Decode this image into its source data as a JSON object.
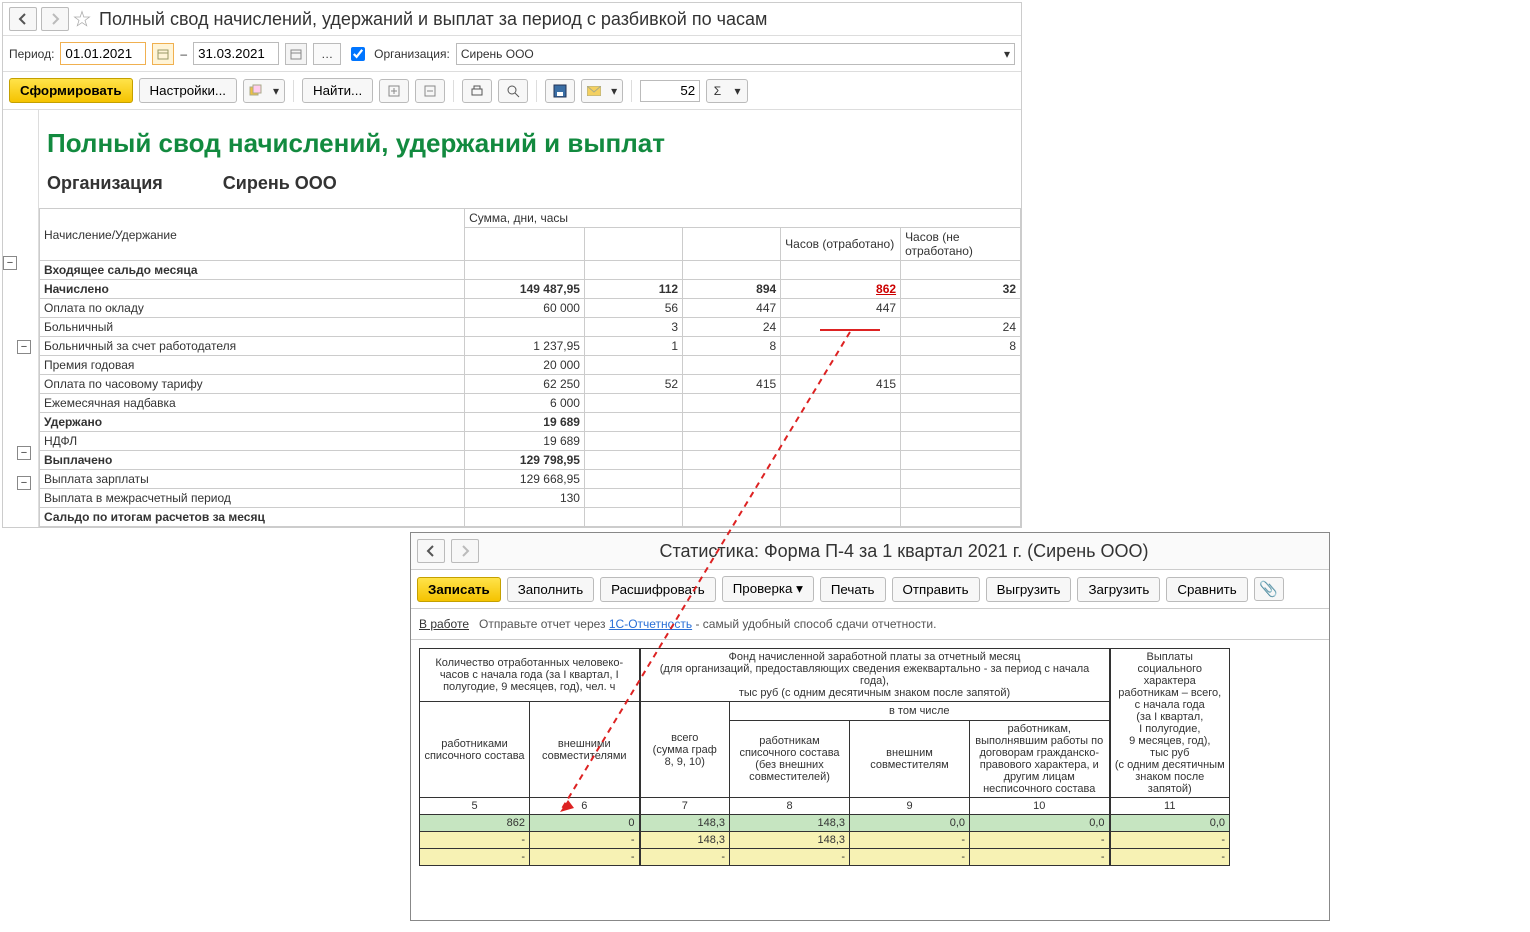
{
  "window1": {
    "title": "Полный свод начислений, удержаний и выплат за период с разбивкой по часам",
    "period_label": "Период:",
    "date_from": "01.01.2021",
    "date_to": "31.03.2021",
    "org_label": "Организация:",
    "org_value": "Сирень ООО",
    "form_btn": "Сформировать",
    "settings_btn": "Настройки...",
    "find_btn": "Найти...",
    "value_52": "52"
  },
  "report": {
    "title": "Полный свод начислений, удержаний и выплат",
    "org_label": "Организация",
    "org_name": "Сирень ООО",
    "col_header_left": "Начисление/Удержание",
    "col_header_right": "Сумма, дни, часы",
    "subhead_worked": "Часов (отработано)",
    "subhead_notworked": "Часов (не отработано)",
    "rows": [
      {
        "label": "Входящее сальдо месяца",
        "bold": true
      },
      {
        "label": "Начислено",
        "bold": true,
        "v1": "149 487,95",
        "v2": "112",
        "v3": "894",
        "v4": "862",
        "v5": "32"
      },
      {
        "label": "Оплата по окладу",
        "v1": "60 000",
        "v2": "56",
        "v3": "447",
        "v4": "447"
      },
      {
        "label": "Больничный",
        "v2": "3",
        "v3": "24",
        "v5": "24"
      },
      {
        "label": "Больничный за счет работодателя",
        "v1": "1 237,95",
        "v2": "1",
        "v3": "8",
        "v5": "8"
      },
      {
        "label": "Премия годовая",
        "v1": "20 000"
      },
      {
        "label": "Оплата по часовому тарифу",
        "v1": "62 250",
        "v2": "52",
        "v3": "415",
        "v4": "415"
      },
      {
        "label": "Ежемесячная надбавка",
        "v1": "6 000"
      },
      {
        "label": "Удержано",
        "bold": true,
        "v1": "19 689"
      },
      {
        "label": "НДФЛ",
        "v1": "19 689"
      },
      {
        "label": "Выплачено",
        "bold": true,
        "v1": "129 798,95"
      },
      {
        "label": "Выплата зарплаты",
        "v1": "129 668,95"
      },
      {
        "label": "Выплата в межрасчетный период",
        "v1": "130"
      },
      {
        "label": "Сальдо по итогам расчетов за месяц",
        "bold": true
      }
    ]
  },
  "window2": {
    "title": "Статистика: Форма П-4 за 1 квартал 2021 г. (Сирень ООО)",
    "save_btn": "Записать",
    "fill_btn": "Заполнить",
    "decode_btn": "Расшифровать",
    "check_btn": "Проверка",
    "print_btn": "Печать",
    "send_btn": "Отправить",
    "export_btn": "Выгрузить",
    "import_btn": "Загрузить",
    "compare_btn": "Сравнить",
    "status": "В работе",
    "status_text1": "Отправьте отчет через ",
    "status_link": "1С-Отчетность",
    "status_text2": " - самый удобный способ сдачи отчетности."
  },
  "p4": {
    "hdr_hours": "Количество отработанных человеко-часов с начала года (за I квартал, I полугодие, 9 месяцев, год), чел. ч",
    "hdr_hours_sub1": "работниками списочного состава",
    "hdr_hours_sub2": "внешними совместителями",
    "hdr_fund": "Фонд начисленной заработной платы за отчетный месяц\n(для организаций, предоставляющих сведения ежеквартально - за период с начала года),\nтыс руб (с одним десятичным знаком после запятой)",
    "hdr_fund_total": "всего\n(сумма граф\n8, 9, 10)",
    "hdr_fund_incl": "в том числе",
    "hdr_fund_sub1": "работникам списочного состава (без внешних совместителей)",
    "hdr_fund_sub2": "внешним совместителям",
    "hdr_fund_sub3": "работникам, выполнявшим работы по договорам гражданско-правового характера, и другим лицам несписочного состава",
    "hdr_social": "Выплаты социального характера работникам – всего, с начала года\n(за I квартал,\nI полугодие,\n9 месяцев, год),\nтыс руб\n(с одним десятичным знаком после запятой)",
    "col5": "5",
    "col6": "6",
    "col7": "7",
    "col8": "8",
    "col9": "9",
    "col10": "10",
    "col11": "11",
    "r1": {
      "c5": "862",
      "c6": "0",
      "c7": "148,3",
      "c8": "148,3",
      "c9": "0,0",
      "c10": "0,0",
      "c11": "0,0"
    },
    "r2": {
      "c5": "-",
      "c6": "-",
      "c7": "148,3",
      "c8": "148,3",
      "c9": "-",
      "c10": "-",
      "c11": "-"
    },
    "r3": {
      "c5": "-",
      "c6": "-",
      "c7": "-",
      "c8": "-",
      "c9": "-",
      "c10": "-",
      "c11": "-"
    }
  }
}
